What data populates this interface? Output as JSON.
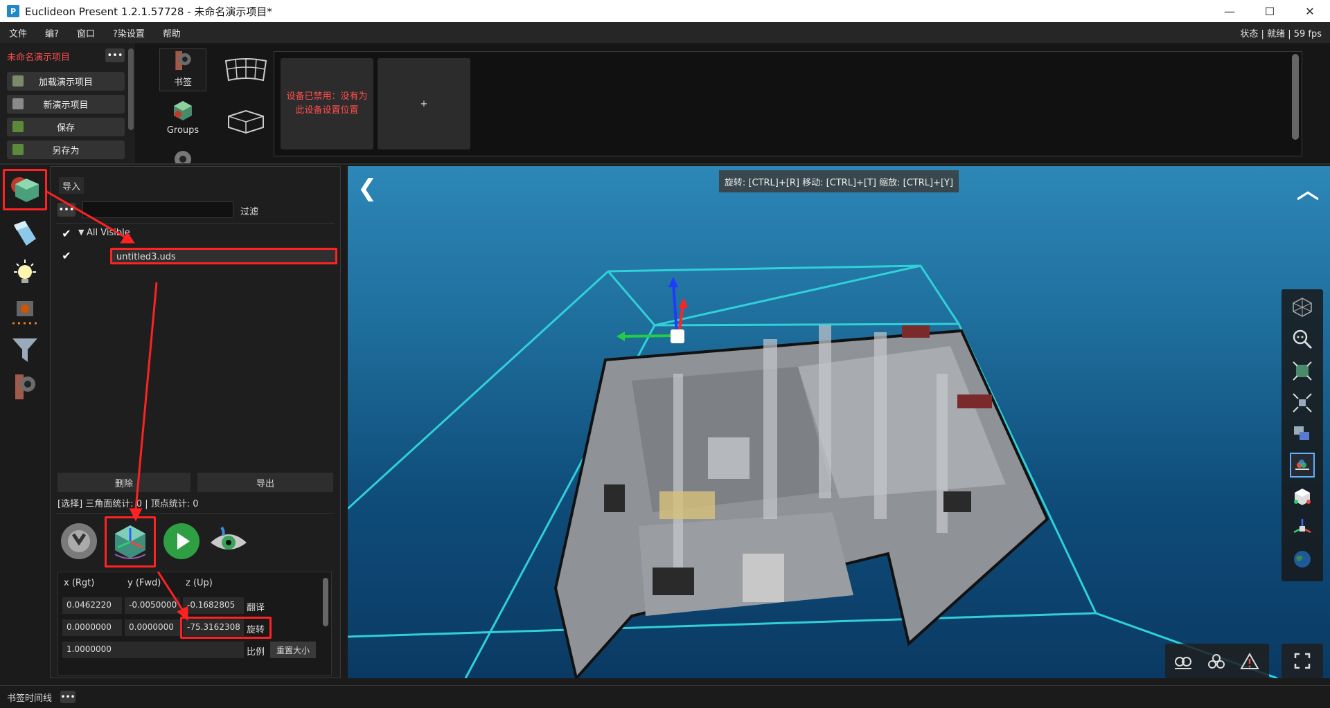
{
  "window": {
    "title": "Euclideon Present 1.2.1.57728 - 未命名演示项目*",
    "minimize": "—",
    "maximize": "☐",
    "close": "✕"
  },
  "menu": {
    "items": [
      "文件",
      "编?",
      "窗口",
      "?染设置",
      "帮助"
    ],
    "status": "状态 | 就绪 | 59 fps"
  },
  "project": {
    "title": "未命名演示项目",
    "more": "•••",
    "buttons": [
      "加载演示项目",
      "新演示项目",
      "保存",
      "另存为"
    ]
  },
  "tabs": {
    "bookmarks": "书签",
    "groups": "Groups"
  },
  "devices": {
    "disabled_message": "设备已禁用：没有为此设备设置位置",
    "add_label": "+"
  },
  "scene": {
    "import_tab": "导入",
    "filter_more": "•••",
    "filter_label": "过滤",
    "filter_value": "",
    "tree_root": "All Visible",
    "tree_item": "untitled3.uds",
    "delete": "删除",
    "export": "导出",
    "stats": "[选择] 三角面统计: 0 | 顶点统计: 0"
  },
  "transform": {
    "headers": [
      "x (Rgt)",
      "y (Fwd)",
      "z (Up)"
    ],
    "translate": [
      "0.0462220",
      "-0.0050000",
      "-0.1682805"
    ],
    "translate_label": "翻译",
    "rotate": [
      "0.0000000",
      "0.0000000",
      "-75.3162308"
    ],
    "rotate_label": "旋转",
    "scale": "1.0000000",
    "scale_label": "比例",
    "reset": "重置大小"
  },
  "viewport": {
    "hint": "旋转: [CTRL]+[R]   移动: [CTRL]+[T]   缩放: [CTRL]+[Y]",
    "back": "❮",
    "collapse": "︿"
  },
  "timeline": {
    "label": "书签时间线",
    "more": "•••"
  },
  "colors": {
    "accent_red": "#ff4d4d",
    "highlight": "#ff2222",
    "bbox": "#30d0d8",
    "ocean": "#1f6f9d"
  }
}
